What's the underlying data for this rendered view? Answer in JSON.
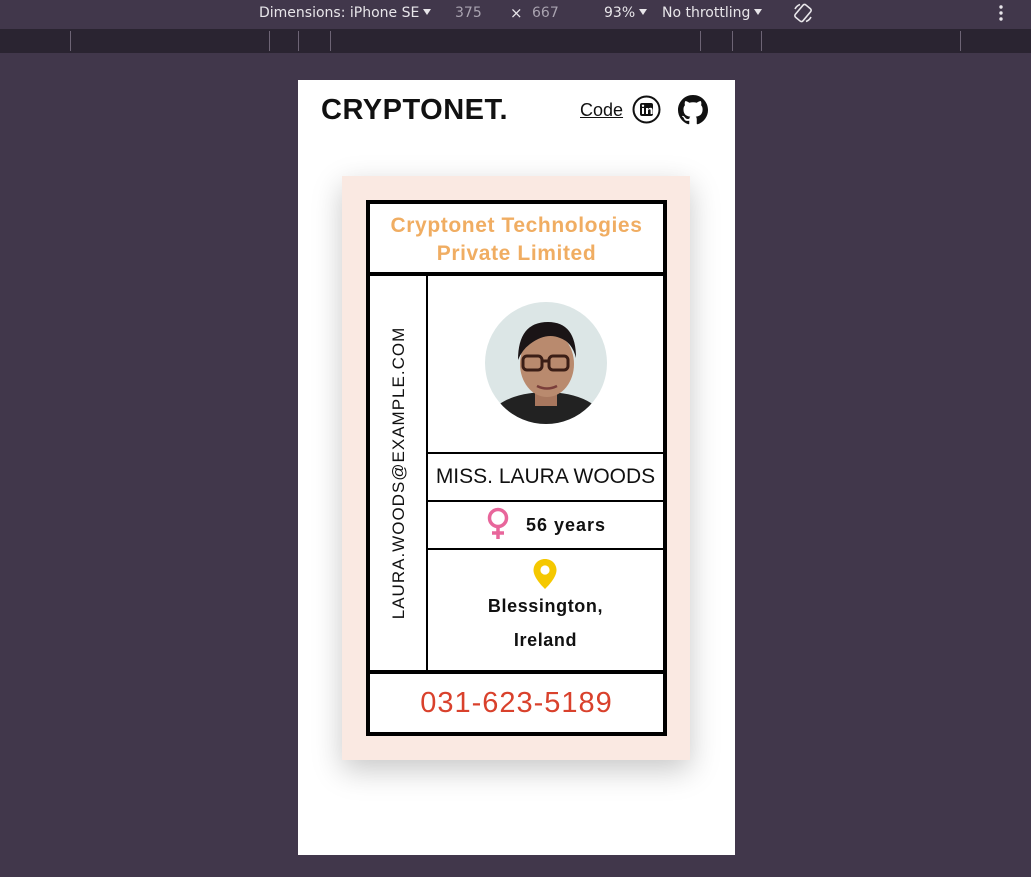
{
  "devtools": {
    "dimensions_label": "Dimensions: iPhone SE",
    "width_value": "375",
    "times_symbol": "×",
    "height_value": "667",
    "zoom_label": "93%",
    "throttling_label": "No throttling"
  },
  "header": {
    "brand": "CRYPTONET.",
    "code_link": "Code",
    "linkedin_icon": "linkedin-icon",
    "github_icon": "github-icon"
  },
  "card": {
    "company": "Cryptonet Technologies Private Limited",
    "email": "LAURA.WOODS@EXAMPLE.COM",
    "name": "MISS. LAURA WOODS",
    "gender_icon": "female-icon",
    "age": "56 years",
    "location_icon": "map-pin-icon",
    "city": "Blessington,",
    "country": "Ireland",
    "phone": "031-623-5189"
  },
  "colors": {
    "company_text": "#f0ad62",
    "phone_text": "#d9412c",
    "female_icon": "#e8669b",
    "pin_icon": "#f5c800",
    "card_background": "#fae9e2",
    "devtools_background": "#41374b"
  }
}
